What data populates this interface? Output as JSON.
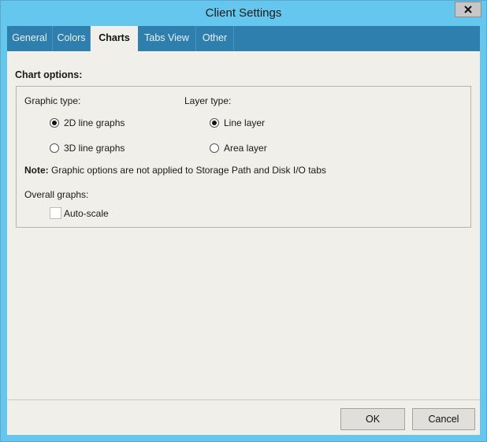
{
  "window": {
    "title": "Client Settings"
  },
  "tabs": [
    {
      "label": "General"
    },
    {
      "label": "Colors"
    },
    {
      "label": "Charts",
      "active": true
    },
    {
      "label": "Tabs View"
    },
    {
      "label": "Other"
    }
  ],
  "chart_options": {
    "section_title": "Chart options:",
    "graphic_type": {
      "label": "Graphic type:",
      "options": [
        {
          "label": "2D line graphs",
          "checked": true
        },
        {
          "label": "3D line graphs",
          "checked": false
        }
      ]
    },
    "layer_type": {
      "label": "Layer type:",
      "options": [
        {
          "label": "Line layer",
          "checked": true
        },
        {
          "label": "Area layer",
          "checked": false
        }
      ]
    },
    "note": {
      "bold": "Note:",
      "text": "Graphic options are not applied to Storage Path and Disk I/O tabs"
    },
    "overall_graphs": {
      "label": "Overall graphs:",
      "auto_scale": {
        "label": "Auto-scale",
        "checked": false
      }
    }
  },
  "footer": {
    "ok_label": "OK",
    "cancel_label": "Cancel"
  },
  "colors": {
    "titlebar": "#66c7ee",
    "tabbar": "#2e7fad",
    "panel": "#f0efe9"
  }
}
